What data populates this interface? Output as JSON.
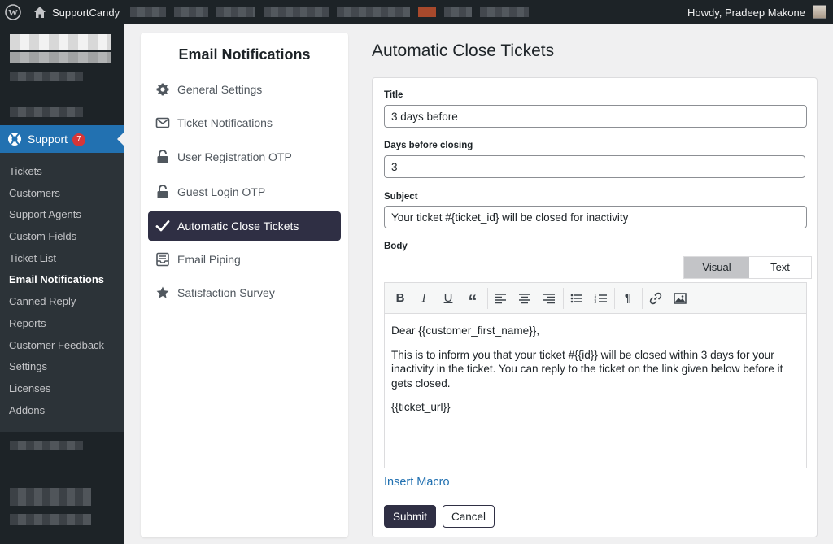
{
  "adminbar": {
    "site_name": "SupportCandy",
    "howdy": "Howdy, Pradeep Makone"
  },
  "sidebar": {
    "support_label": "Support",
    "support_badge": "7",
    "submenu": [
      "Tickets",
      "Customers",
      "Support Agents",
      "Custom Fields",
      "Ticket List",
      "Email Notifications",
      "Canned Reply",
      "Reports",
      "Customer Feedback",
      "Settings",
      "Licenses",
      "Addons"
    ],
    "current_item": "Email Notifications"
  },
  "nav_panel": {
    "title": "Email Notifications",
    "items": [
      {
        "label": "General Settings",
        "icon": "gear-icon"
      },
      {
        "label": "Ticket Notifications",
        "icon": "envelope-icon"
      },
      {
        "label": "User Registration OTP",
        "icon": "unlock-icon"
      },
      {
        "label": "Guest Login OTP",
        "icon": "unlock-icon"
      },
      {
        "label": "Automatic Close Tickets",
        "icon": "check-icon",
        "active": true
      },
      {
        "label": "Email Piping",
        "icon": "inbox-icon"
      },
      {
        "label": "Satisfaction Survey",
        "icon": "star-icon"
      }
    ]
  },
  "main": {
    "page_title": "Automatic Close Tickets",
    "form": {
      "title_label": "Title",
      "title_value": "3 days before",
      "days_label": "Days before closing",
      "days_value": "3",
      "subject_label": "Subject",
      "subject_value": "Your ticket #{ticket_id} will be closed for inactivity",
      "body_label": "Body",
      "tab_visual": "Visual",
      "tab_text": "Text",
      "body": {
        "p1": "Dear {{customer_first_name}},",
        "p2": "This is to inform you that your ticket #{{id}} will be closed within 3 days for your inactivity in the ticket. You can reply to the ticket on the link given below before it gets closed.",
        "p3": "{{ticket_url}}"
      },
      "insert_macro": "Insert Macro",
      "submit": "Submit",
      "cancel": "Cancel"
    }
  },
  "colors": {
    "accent": "#2f2f44",
    "wp_blue": "#2271b1",
    "admin_dark": "#1d2327",
    "badge_red": "#d63638"
  }
}
